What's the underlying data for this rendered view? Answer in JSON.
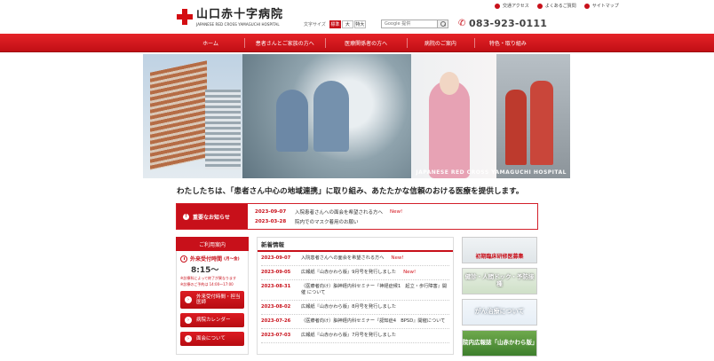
{
  "header": {
    "logo_jp": "山口赤十字病院",
    "logo_en": "JAPANESE RED CROSS YAMAGUCHI HOSPITAL",
    "font_size_label": "文字サイズ",
    "font_sizes": [
      "標準",
      "大",
      "特大"
    ],
    "search_placeholder": "Google 提供",
    "top_links": [
      "交通アクセス",
      "よくあるご質問",
      "サイトマップ"
    ],
    "phone": "083-923-0111"
  },
  "nav": {
    "items": [
      "ホーム",
      "患者さんとご家族の方へ",
      "医療関係者の方へ",
      "病院のご案内",
      "特色・取り組み"
    ]
  },
  "hero": {
    "caption": "JAPANESE RED CROSS YAMAGUCHI HOSPITAL"
  },
  "tagline": "わたしたちは、「患者さん中心の地域連携」に取り組み、あたたかな信頼のおける医療を提供します。",
  "notice": {
    "label": "重要なお知らせ",
    "items": [
      {
        "date": "2023-09-07",
        "title": "入院患者さんへの面会を希望される方へ",
        "new": "New!"
      },
      {
        "date": "2023-03-28",
        "title": "院内でのマスク着用のお願い",
        "new": ""
      }
    ]
  },
  "left": {
    "header": "ご利用案内",
    "hours_title": "外来受付時間",
    "hours_days": "(月〜金)",
    "hours_time": "8:15〜",
    "hours_note_1": "※診療科によって終了が異なります",
    "hours_note_2": "※診療のご予約は 14:00〜17:00",
    "buttons": [
      "外来受付時間・担当医師",
      "病院カレンダー",
      "面会について"
    ]
  },
  "news": {
    "header": "新着情報",
    "items": [
      {
        "date": "2023-09-07",
        "title": "入院患者さんへの面会を希望される方へ",
        "new": "New!"
      },
      {
        "date": "2023-09-05",
        "title": "広報紙『山赤かわら版』9月号を発行しました",
        "new": "New!"
      },
      {
        "date": "2023-08-31",
        "title": "（医療者向け）脳神経内科セミナー『神経症候1　起立・歩行障害』開催 について",
        "new": ""
      },
      {
        "date": "2023-08-02",
        "title": "広報紙『山赤かわら版』8月号を発行しました",
        "new": ""
      },
      {
        "date": "2023-07-26",
        "title": "（医療者向け）脳神経内科セミナー『認知症4　BPSD』開催について",
        "new": ""
      },
      {
        "date": "2023-07-03",
        "title": "広報紙『山赤かわら版』7月号を発行しました",
        "new": ""
      }
    ]
  },
  "banners": [
    "初期臨床研修医募集",
    "健診・人間ドック・予防接種",
    "がん治療について",
    "院内広報誌「山赤かわら版」"
  ],
  "colors": {
    "brand_red": "#c8101a",
    "nav_red": "#e52327"
  }
}
